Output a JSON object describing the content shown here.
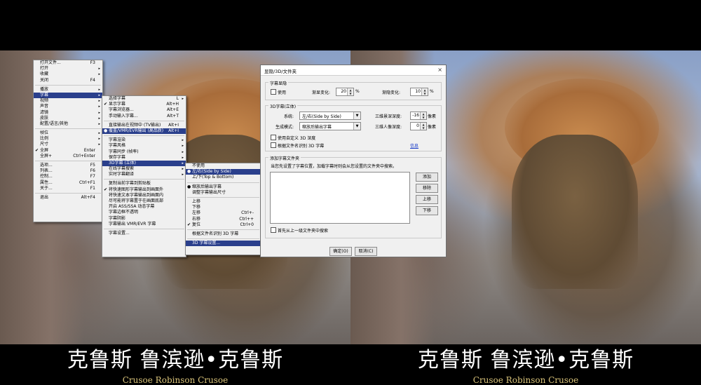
{
  "subtitles": {
    "left_line1": "克鲁斯 鲁滨逊•克鲁斯",
    "left_line2": "Crusoe   Robinson Crusoe",
    "right_line1": "克鲁斯 鲁滨逊•克鲁斯",
    "right_line2": "Crusoe   Robinson Crusoe"
  },
  "main_menu": [
    {
      "label": "打开文件...",
      "shortcut": "F3",
      "arrow": ""
    },
    {
      "label": "打开",
      "shortcut": "",
      "arrow": "▸"
    },
    {
      "label": "收藏",
      "shortcut": "",
      "arrow": "▸"
    },
    {
      "label": "关闭",
      "shortcut": "F4",
      "arrow": ""
    },
    {
      "sep": true
    },
    {
      "label": "播放",
      "shortcut": "",
      "arrow": "▸"
    },
    {
      "label": "字幕",
      "shortcut": "",
      "arrow": "▸",
      "highlight": true
    },
    {
      "label": "视频",
      "shortcut": "",
      "arrow": "▸"
    },
    {
      "label": "声音",
      "shortcut": "",
      "arrow": "▸"
    },
    {
      "label": "滤镜",
      "shortcut": "",
      "arrow": "▸"
    },
    {
      "label": "皮肤",
      "shortcut": "",
      "arrow": "▸"
    },
    {
      "label": "配置/语言/其他",
      "shortcut": "",
      "arrow": "▸"
    },
    {
      "sep": true
    },
    {
      "label": "帧位",
      "shortcut": "",
      "arrow": "▸"
    },
    {
      "label": "比例",
      "shortcut": "",
      "arrow": "▸"
    },
    {
      "label": "尺寸",
      "shortcut": "",
      "arrow": "▸"
    },
    {
      "label": "全屏",
      "shortcut": "Enter",
      "arrow": "",
      "check": "✔"
    },
    {
      "label": "全屏+",
      "shortcut": "Ctrl+Enter",
      "arrow": ""
    },
    {
      "sep": true
    },
    {
      "label": "选项...",
      "shortcut": "F5",
      "arrow": ""
    },
    {
      "label": "列表...",
      "shortcut": "F6",
      "arrow": ""
    },
    {
      "label": "控制...",
      "shortcut": "F7",
      "arrow": ""
    },
    {
      "label": "属性...",
      "shortcut": "Ctrl+F1",
      "arrow": ""
    },
    {
      "label": "关于...",
      "shortcut": "F1",
      "arrow": ""
    },
    {
      "sep": true
    },
    {
      "label": "退出",
      "shortcut": "Alt+F4",
      "arrow": ""
    }
  ],
  "subtitle_menu": [
    {
      "label": "选择字幕",
      "shortcut": "L",
      "arrow": "▸"
    },
    {
      "label": "显示字幕",
      "shortcut": "Alt+H",
      "arrow": "",
      "check": "✔"
    },
    {
      "label": "字幕浏览器...",
      "shortcut": "Alt+E",
      "arrow": ""
    },
    {
      "label": "手动输入字幕...",
      "shortcut": "Alt+T",
      "arrow": ""
    },
    {
      "sep": true
    },
    {
      "label": "直接输出在视频中 (TV输出)",
      "shortcut": "Alt+I",
      "arrow": ""
    },
    {
      "label": "覆盖/VMR/EVR输出 (高品质)",
      "shortcut": "Alt+I",
      "arrow": "",
      "check": "●",
      "highlight": true
    },
    {
      "sep": true
    },
    {
      "label": "字幕渲染",
      "shortcut": "",
      "arrow": "▸"
    },
    {
      "label": "字幕风格",
      "shortcut": "",
      "arrow": "▸"
    },
    {
      "label": "字幕同步 (帧率)",
      "shortcut": "",
      "arrow": "▸"
    },
    {
      "label": "保存字幕",
      "shortcut": "",
      "arrow": "▸"
    },
    {
      "label": "3D字幕 (立体)",
      "shortcut": "",
      "arrow": "▸",
      "highlight": true
    },
    {
      "label": "在线字幕搜索",
      "shortcut": "",
      "arrow": "▸"
    },
    {
      "label": "实时字幕翻译",
      "shortcut": "",
      "arrow": "▸"
    },
    {
      "sep": true
    },
    {
      "label": "复制当前字幕到剪贴板",
      "shortcut": "",
      "arrow": ""
    },
    {
      "label": "将快速图形字幕输出到画面外",
      "shortcut": "",
      "arrow": "",
      "check": "✔"
    },
    {
      "label": "将快速文本字幕输出到画面内",
      "shortcut": "",
      "arrow": ""
    },
    {
      "label": "尽可能将字幕置于在画面底部",
      "shortcut": "",
      "arrow": ""
    },
    {
      "label": "开启 ASS/SSA 动态字幕",
      "shortcut": "",
      "arrow": ""
    },
    {
      "label": "字幕边框不透明",
      "shortcut": "",
      "arrow": ""
    },
    {
      "label": "字幕阴影",
      "shortcut": "",
      "arrow": ""
    },
    {
      "label": "字幕输出 VMR/EVR 字幕",
      "shortcut": "",
      "arrow": ""
    },
    {
      "sep": true
    },
    {
      "label": "字幕设置...",
      "shortcut": "",
      "arrow": ""
    }
  ],
  "stereo_menu": [
    {
      "label": "不使用",
      "shortcut": "",
      "arrow": ""
    },
    {
      "label": "左/右(Side by Side)",
      "shortcut": "",
      "arrow": "",
      "check": "●",
      "highlight": true
    },
    {
      "label": "上/下(Top & Bottom)",
      "shortcut": "",
      "arrow": ""
    },
    {
      "sep": true
    },
    {
      "label": "缩放后输出字幕",
      "shortcut": "",
      "arrow": "",
      "check": "●"
    },
    {
      "label": "调整字幕输出尺寸",
      "shortcut": "",
      "arrow": ""
    },
    {
      "sep": true
    },
    {
      "label": "上移",
      "shortcut": "",
      "arrow": ""
    },
    {
      "label": "下移",
      "shortcut": "",
      "arrow": ""
    },
    {
      "label": "左移",
      "shortcut": "Ctrl+-",
      "arrow": ""
    },
    {
      "label": "右移",
      "shortcut": "Ctrl++",
      "arrow": ""
    },
    {
      "label": "复位",
      "shortcut": "Ctrl+0",
      "arrow": "",
      "check": "✔"
    },
    {
      "sep": true
    },
    {
      "label": "根据文件名识别 3D 字幕",
      "shortcut": "",
      "arrow": ""
    },
    {
      "sep": true
    },
    {
      "label": "3D 字幕设置...",
      "shortcut": "",
      "arrow": "",
      "highlight": true
    }
  ],
  "dialog": {
    "title": "显隐/3D/文件夹",
    "close": "×",
    "hide_group": {
      "caption": "字幕显隐",
      "use_label": "使用",
      "gradual_label": "渐显变化:",
      "gradual_value": "20",
      "gradual_unit": "%",
      "fade_label": "渐隐变化:",
      "fade_value": "10",
      "fade_unit": "%"
    },
    "stereo_group": {
      "caption": "3D字幕(立体)",
      "system_label": "系统:",
      "system_value": "左/右(Side by Side)",
      "output_label": "生成模式:",
      "output_value": "缩放后输出字幕",
      "depth_label": "三维景深深度:",
      "depth_value": "-16",
      "depth_unit": "像素",
      "offset_label": "三维人像深度:",
      "offset_value": "0",
      "offset_unit": "像素",
      "custom_depth_label": "使用自定义 3D 深度",
      "by_filename_label": "根据文件名识别 3D 字幕",
      "info_link": "信息"
    },
    "folder_group": {
      "caption": "添加字幕文件夹",
      "hint": "当您先设置了字幕位置，加载字幕时则会从您设置的文件夹中搜索。",
      "add": "添加",
      "remove": "移除",
      "up": "上移",
      "down": "下移",
      "parent_label": "首先从上一级文件夹中搜索"
    },
    "ok": "确定(O)",
    "cancel": "取消(C)"
  }
}
